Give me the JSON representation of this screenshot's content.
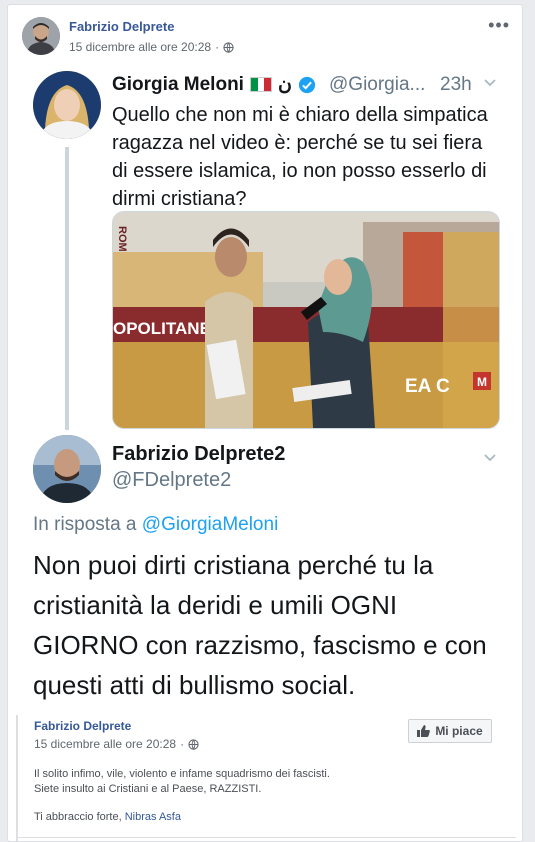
{
  "post": {
    "author": "Fabrizio Delprete",
    "timestamp": "15 dicembre alle ore 20:28",
    "privacy_icon": "globe-icon",
    "more_icon": "more-dots-icon"
  },
  "tweet_original": {
    "name": "Giorgia Meloni",
    "emoji_text": "ن",
    "handle": "@Giorgia...",
    "time": "23h",
    "text_lines": [
      "Quello che non mi è chiaro della simpatica",
      "ragazza nel video è: perché se tu sei fiera",
      "di essere islamica, io non posso esserlo di",
      "dirmi cristiana?"
    ],
    "photo_signs": {
      "sign_left": "OPOLITANE",
      "sign_right": "EA C",
      "sign_top": "ROM",
      "badge": "M"
    }
  },
  "tweet_reply": {
    "name": "Fabrizio Delprete2",
    "handle": "@FDelprete2",
    "reply_prefix": "In risposta a",
    "reply_mention": "@GiorgiaMeloni",
    "text_lines": [
      "Non puoi dirti cristiana perché tu la",
      "cristianità la deridi e umili OGNI",
      "GIORNO con razzismo, fascismo e con",
      "questi atti di bullismo social."
    ]
  },
  "comment": {
    "author": "Fabrizio Delprete",
    "timestamp": "15 dicembre alle ore 20:28",
    "like_label": "Mi piace",
    "text_lines": [
      "Il solito infimo, vile, violento e infame squadrismo dei fascisti.",
      "Siete insulto ai Cristiani e al Paese, RAZZISTI."
    ],
    "sign_prefix": "Ti abbraccio forte,",
    "sign_link": "Nibras Asfa"
  },
  "colors": {
    "facebook_link": "#385898",
    "twitter_blue": "#1da1f2",
    "twitter_gray": "#657786"
  }
}
